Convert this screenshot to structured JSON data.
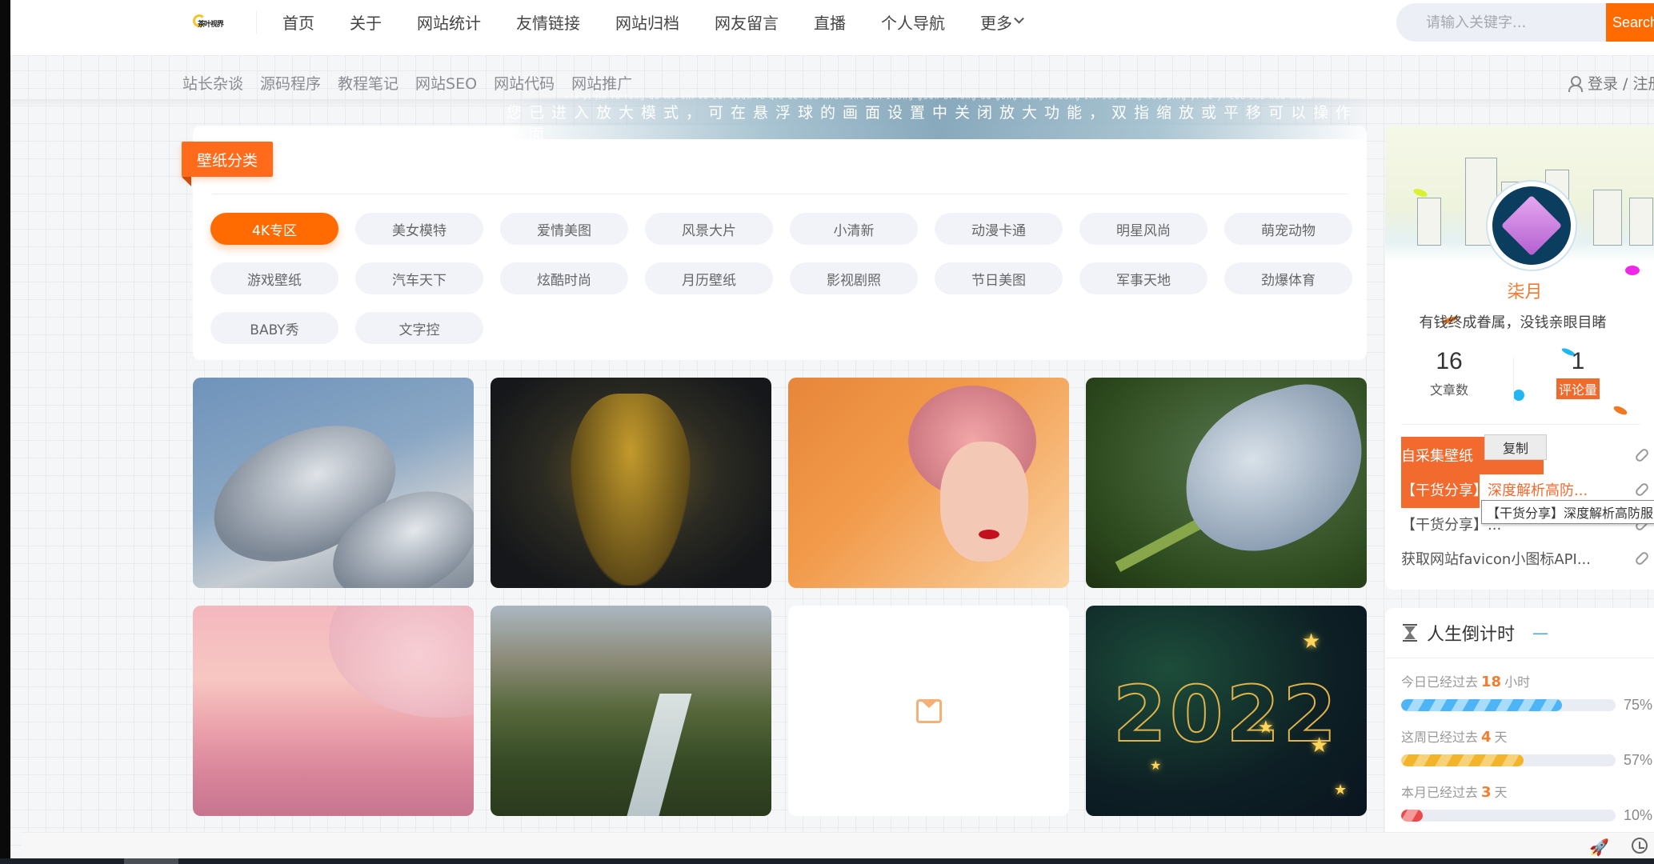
{
  "header": {
    "logo_text": "茶叶视界",
    "nav": [
      "首页",
      "关于",
      "网站统计",
      "友情链接",
      "网站归档",
      "网友留言",
      "直播",
      "个人导航"
    ],
    "more_label": "更多",
    "search": {
      "placeholder": "请输入关键字...",
      "button_label": "Search"
    }
  },
  "subnav": {
    "items": [
      "站长杂谈",
      "源码程序",
      "教程笔记",
      "网站SEO",
      "网站代码",
      "网站推广"
    ],
    "login_label": "登录 / 注册"
  },
  "zoom_banner": {
    "pinyin": "nín yǐ jìn rù fàng dà mó shì   kě zài xuán fú qiú de huà miàn shè zhì zhōng guān bì fàng dà gōng néng   shuāng zhǐ suō fàng huò píng yí kě yǐ cāo zuò huà miàn",
    "text": "您已进入放大模式，可在悬浮球的画面设置中关闭放大功能，双指缩放或平移可以操作画面"
  },
  "categories": {
    "title": "壁纸分类",
    "active_index": 0,
    "items": [
      "4K专区",
      "美女模特",
      "爱情美图",
      "风景大片",
      "小清新",
      "动漫卡通",
      "明星风尚",
      "萌宠动物",
      "游戏壁纸",
      "汽车天下",
      "炫酷时尚",
      "月历壁纸",
      "影视剧照",
      "节日美图",
      "军事天地",
      "劲爆体育",
      "BABY秀",
      "文字控"
    ]
  },
  "wallpapers": [
    {
      "subject": "satellite dishes"
    },
    {
      "subject": "yellow robot"
    },
    {
      "subject": "pink-haired woman"
    },
    {
      "subject": "butterfly"
    },
    {
      "subject": "pink clouds"
    },
    {
      "subject": "mountain waterfall"
    },
    {
      "subject": "loading placeholder"
    },
    {
      "subject": "2022 stars",
      "overlay_text": "2022"
    }
  ],
  "profile": {
    "name": "柒月",
    "motto": "有钱终成眷属，没钱亲眼目睹",
    "stats": [
      {
        "value": "16",
        "label": "文章数"
      },
      {
        "value": "1",
        "label": "评论量"
      }
    ],
    "links": [
      {
        "title": "自采集壁纸"
      },
      {
        "title_bracket": "【干货分享】",
        "title_rest": "深度解析高防..."
      },
      {
        "title": "【干货分享】..."
      },
      {
        "title": "获取网站favicon小图标API..."
      }
    ],
    "copy_popup": "复制",
    "tooltip": "【干货分享】深度解析高防服务器"
  },
  "countdown": {
    "title": "人生倒计时",
    "items": [
      {
        "prefix": "今日已经过去",
        "value": "18",
        "unit": "小时",
        "percent": 75,
        "color": "blue"
      },
      {
        "prefix": "这周已经过去",
        "value": "4",
        "unit": "天",
        "percent": 57,
        "color": "yellow"
      },
      {
        "prefix": "本月已经过去",
        "value": "3",
        "unit": "天",
        "percent": 10,
        "color": "red"
      }
    ]
  },
  "colors": {
    "accent": "#ff6b00",
    "highlight": "#f26a2e",
    "blue": "#4db5f5",
    "yellow": "#f3b32b",
    "red": "#e94b4b"
  }
}
